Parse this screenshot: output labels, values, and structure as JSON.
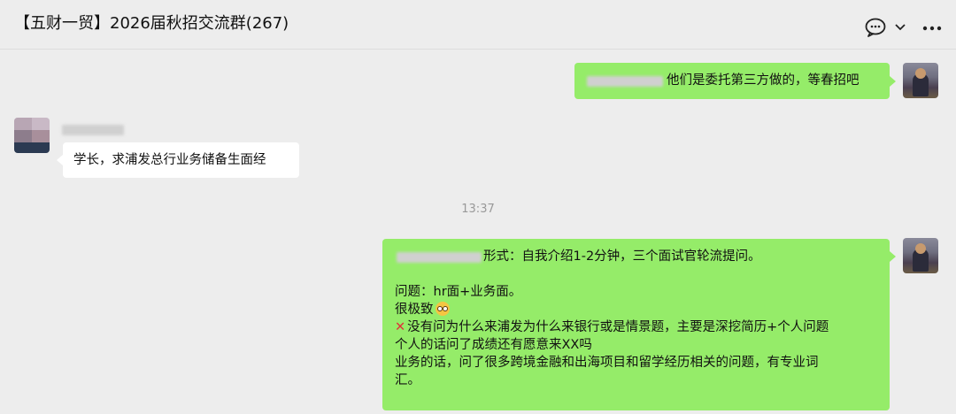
{
  "header": {
    "title": "【五财一贸】2026届秋招交流群(267)",
    "icons": [
      "chat-bubble-icon",
      "chevron-down-icon",
      "more-icon"
    ]
  },
  "messages": [
    {
      "side": "right",
      "text": "他们是委托第三方做的，等春招吧"
    },
    {
      "side": "left",
      "text": "学长，求浦发总行业务储备生面经"
    },
    {
      "side": "right",
      "lines": [
        "形式：自我介绍1-2分钟，三个面试官轮流提问。",
        "问题：hr面+业务面。",
        "很极致",
        "没有问为什么来浦发为什么来银行或是情景题，主要是深挖简历+个人问题",
        "个人的话问了成绩还有愿意来XX吗",
        "业务的话，问了很多跨境金融和出海项目和留学经历相关的问题，有专业词",
        "汇。"
      ]
    }
  ],
  "timestamp": "13:37",
  "colors": {
    "background": "#ededed",
    "bubble_self": "#95ec69",
    "bubble_other": "#ffffff",
    "timestamp": "#999999"
  }
}
